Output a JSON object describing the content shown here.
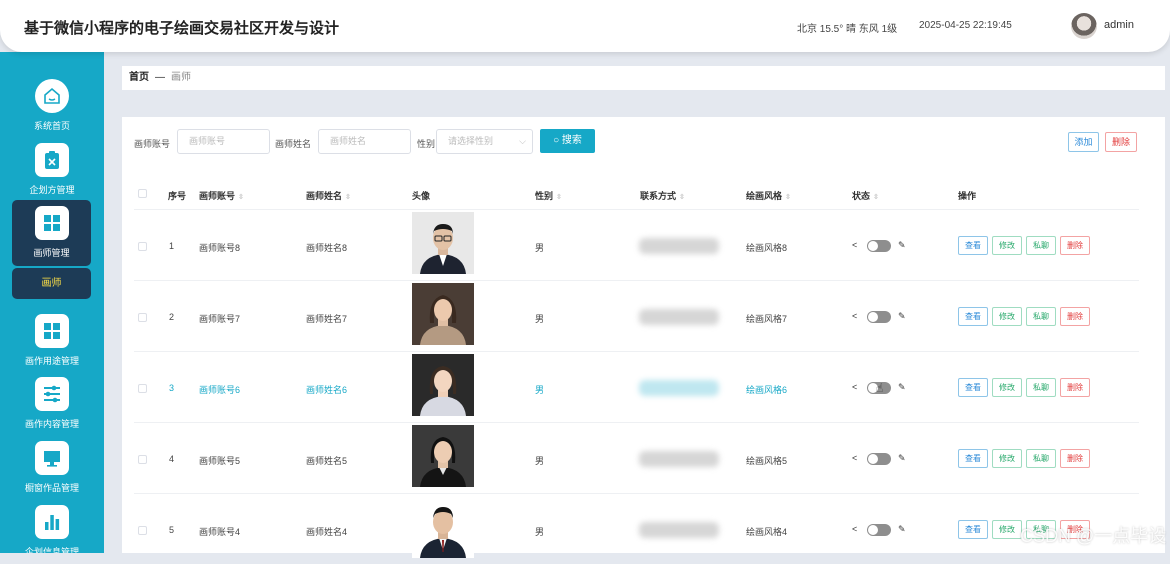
{
  "header": {
    "title": "基于微信小程序的电子绘画交易社区开发与设计",
    "weather": "北京 15.5° 晴 东风 1级",
    "datetime": "2025-04-25 22:19:45",
    "user": "admin"
  },
  "sidebar": {
    "items": [
      {
        "label": "系统首页",
        "icon": "home-icon"
      },
      {
        "label": "企划方管理",
        "icon": "clipboard-icon"
      },
      {
        "label": "画师管理",
        "icon": "grid-icon"
      },
      {
        "label": "画作用途管理",
        "icon": "grid-icon"
      },
      {
        "label": "画作内容管理",
        "icon": "sliders-icon"
      },
      {
        "label": "橱窗作品管理",
        "icon": "monitor-icon"
      },
      {
        "label": "企划信息管理",
        "icon": "bar-chart-icon"
      }
    ],
    "submenu": "画师"
  },
  "breadcrumb": {
    "home": "首页",
    "separator": "—",
    "current": "画师"
  },
  "search": {
    "account_label": "画师账号",
    "account_placeholder": "画师账号",
    "name_label": "画师姓名",
    "name_placeholder": "画师姓名",
    "gender_label": "性别",
    "gender_placeholder": "请选择性别",
    "button": "搜索"
  },
  "actions": {
    "add": "添加",
    "delete": "删除"
  },
  "table": {
    "headers": [
      "序号",
      "画师账号",
      "画师姓名",
      "头像",
      "性别",
      "联系方式",
      "绘画风格",
      "状态",
      "操作"
    ],
    "rows": [
      {
        "index": "1",
        "account": "画师账号8",
        "name": "画师姓名8",
        "gender": "男",
        "style": "绘画风格8"
      },
      {
        "index": "2",
        "account": "画师账号7",
        "name": "画师姓名7",
        "gender": "男",
        "style": "绘画风格7"
      },
      {
        "index": "3",
        "account": "画师账号6",
        "name": "画师姓名6",
        "gender": "男",
        "style": "绘画风格6"
      },
      {
        "index": "4",
        "account": "画师账号5",
        "name": "画师姓名5",
        "gender": "男",
        "style": "绘画风格5"
      },
      {
        "index": "5",
        "account": "画师账号4",
        "name": "画师姓名4",
        "gender": "男",
        "style": "绘画风格4"
      }
    ],
    "row_actions": {
      "view": "查看",
      "edit": "修改",
      "message": "私聊",
      "delete": "删除"
    }
  },
  "watermark": "CSDN @一点毕设",
  "colors": {
    "sidebar": "#16a8c7",
    "active": "#1d3b56",
    "submenu_text": "#fde047",
    "primary": "#16a8c7"
  }
}
